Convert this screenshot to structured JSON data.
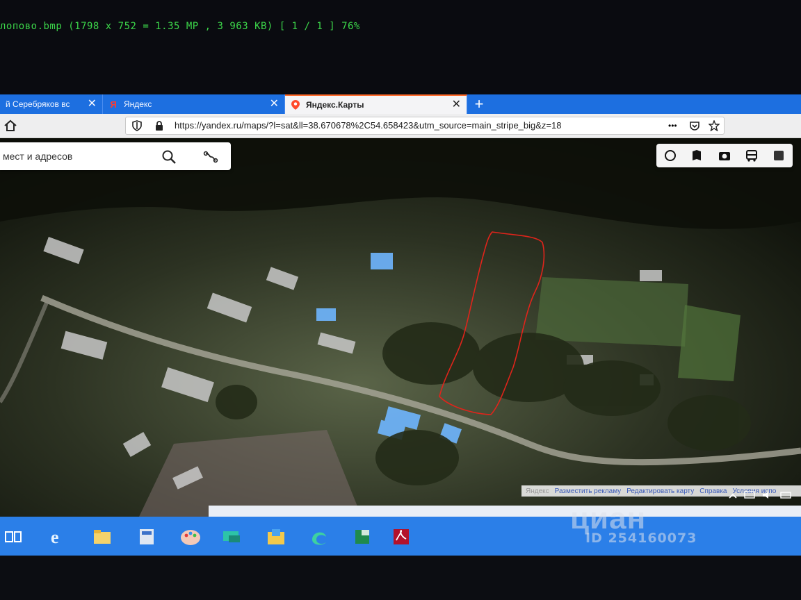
{
  "viewer": {
    "caption": "лопово.bmp  (1798 x 752 = 1.35 MP  ,  3 963 KB)  [ 1 / 1 ]  76%"
  },
  "browser": {
    "tabs": [
      {
        "label": "й Серебряков вс",
        "active": false
      },
      {
        "label": "Яндекс",
        "active": false
      },
      {
        "label": "Яндекс.Карты",
        "active": true
      }
    ],
    "new_tab": "+",
    "close_glyph": "✕",
    "url": "https://yandex.ru/maps/?l=sat&ll=38.670678%2C54.658423&utm_source=main_stripe_big&z=18",
    "more": "•••"
  },
  "map": {
    "search_placeholder": "мест и адресов",
    "copyright_links": [
      "Яндекс",
      "Разместить рекламу",
      "Редактировать карту",
      "Справка",
      "Условия испо"
    ],
    "outline_color": "#e0241b"
  },
  "watermark": {
    "logo": "циан",
    "id": "ID 254160073"
  },
  "colors": {
    "tabbar": "#1d6fe0",
    "taskbar": "#2b7fe8",
    "caption_green": "#3cd64a"
  }
}
